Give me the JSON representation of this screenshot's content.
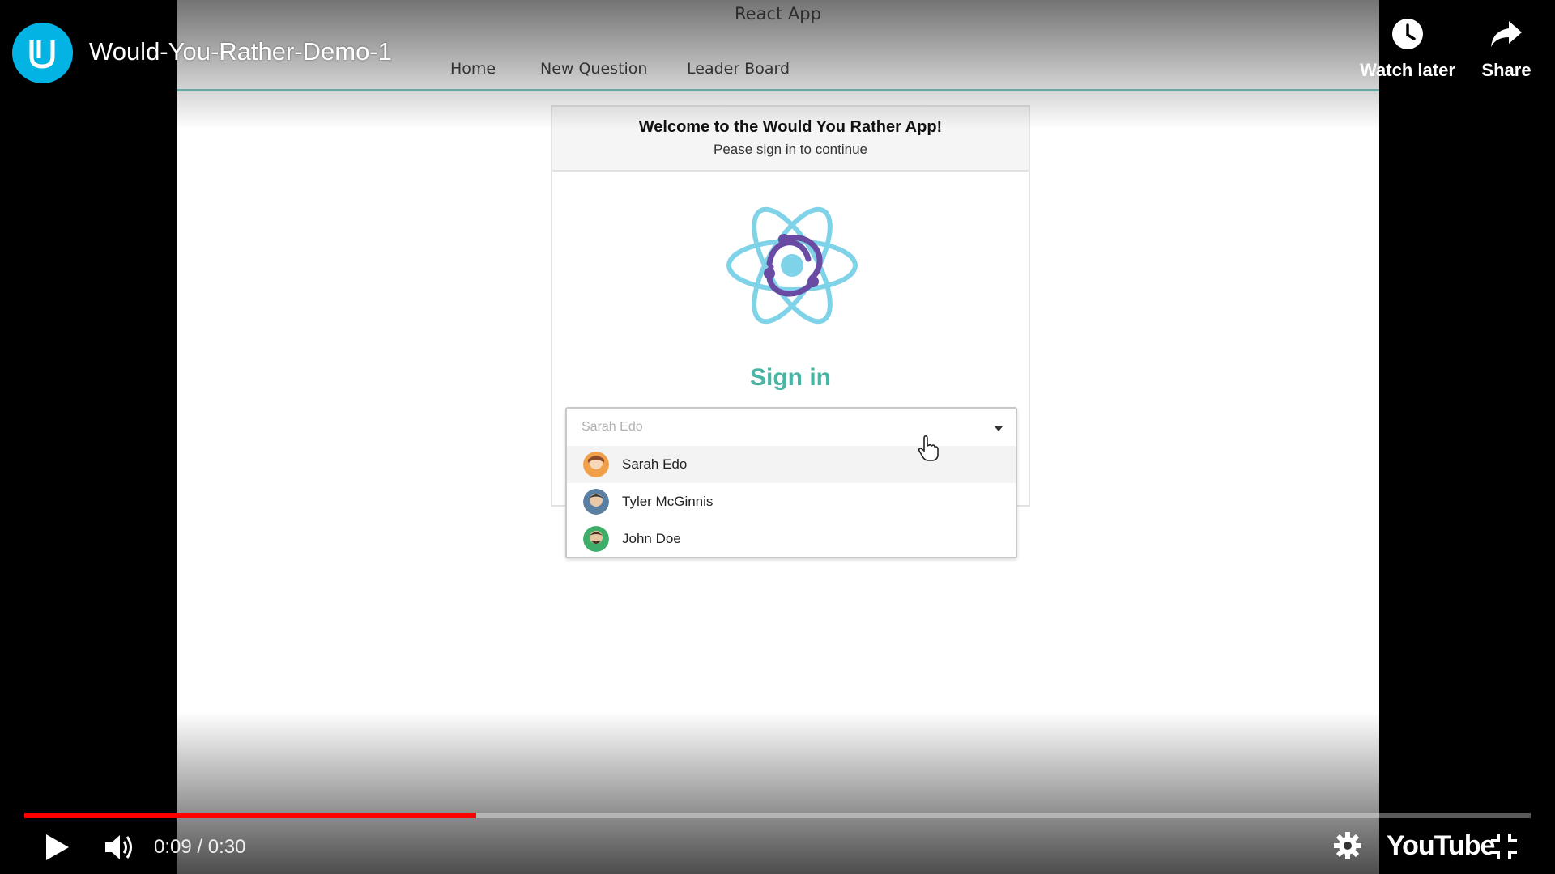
{
  "app": {
    "window_title": "React App",
    "nav": [
      "Home",
      "New Question",
      "Leader Board"
    ],
    "welcome": "Welcome to the Would You Rather App!",
    "please": "Pease sign in to continue",
    "sign_in": "Sign in",
    "select_value": "Sarah Edo",
    "options": [
      {
        "label": "Sarah Edo",
        "active": true
      },
      {
        "label": "Tyler McGinnis",
        "active": false
      },
      {
        "label": "John Doe",
        "active": false
      }
    ]
  },
  "player": {
    "video_title": "Would-You-Rather-Demo-1",
    "watch_later": "Watch later",
    "share": "Share",
    "time": "0:09 / 0:30",
    "progress_fraction": 0.3,
    "youtube_logo": "YouTube"
  },
  "colors": {
    "accent": "#49b5a4",
    "progress": "#ff0000",
    "channel": "#02b3e4"
  }
}
